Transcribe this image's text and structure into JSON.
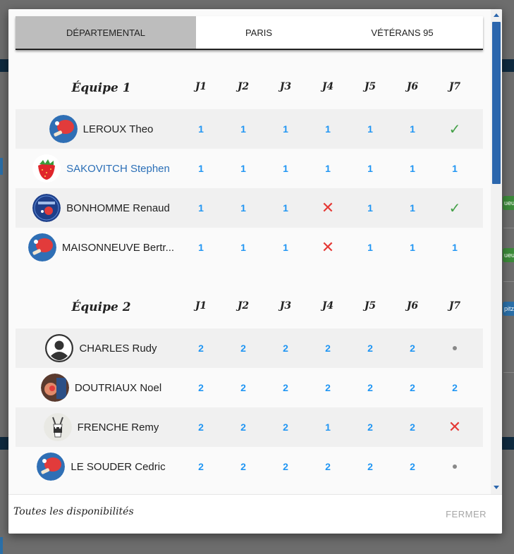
{
  "background": {
    "chips": [
      "ueu",
      "ueu",
      "pitz"
    ]
  },
  "tabs": [
    {
      "label": "DÉPARTEMENTAL",
      "active": true
    },
    {
      "label": "PARIS",
      "active": false
    },
    {
      "label": "VÉTÉRANS 95",
      "active": false
    }
  ],
  "sections": [
    {
      "title": "Équipe 1",
      "days": [
        "J1",
        "J2",
        "J3",
        "J4",
        "J5",
        "J6",
        "J7"
      ],
      "players": [
        {
          "name": "LEROUX Theo",
          "avatar": "ping-pong-paddle-avatar",
          "highlight": false,
          "cells": [
            "1",
            "1",
            "1",
            "1",
            "1",
            "1",
            "check"
          ]
        },
        {
          "name": "SAKOVITCH Stephen",
          "avatar": "strawberry-avatar",
          "highlight": true,
          "cells": [
            "1",
            "1",
            "1",
            "1",
            "1",
            "1",
            "1"
          ]
        },
        {
          "name": "BONHOMME Renaud",
          "avatar": "pingpong-logo-avatar",
          "highlight": false,
          "cells": [
            "1",
            "1",
            "1",
            "x",
            "1",
            "1",
            "check"
          ]
        },
        {
          "name": "MAISONNEUVE Bertr...",
          "avatar": "ping-pong-paddle-avatar",
          "highlight": false,
          "cells": [
            "1",
            "1",
            "1",
            "x",
            "1",
            "1",
            "1"
          ]
        }
      ]
    },
    {
      "title": "Équipe 2",
      "days": [
        "J1",
        "J2",
        "J3",
        "J4",
        "J5",
        "J6",
        "J7"
      ],
      "players": [
        {
          "name": "CHARLES Rudy",
          "avatar": "default-user-avatar",
          "highlight": false,
          "cells": [
            "2",
            "2",
            "2",
            "2",
            "2",
            "2",
            "dot"
          ]
        },
        {
          "name": "DOUTRIAUX Noel",
          "avatar": "photo-avatar",
          "highlight": false,
          "cells": [
            "2",
            "2",
            "2",
            "2",
            "2",
            "2",
            "2"
          ]
        },
        {
          "name": "FRENCHE Remy",
          "avatar": "goat-avatar",
          "highlight": false,
          "cells": [
            "2",
            "2",
            "2",
            "1",
            "2",
            "2",
            "x"
          ]
        },
        {
          "name": "LE SOUDER Cedric",
          "avatar": "ping-pong-paddle-avatar",
          "highlight": false,
          "cells": [
            "2",
            "2",
            "2",
            "2",
            "2",
            "2",
            "dot"
          ]
        }
      ]
    }
  ],
  "footer": {
    "title": "Toutes les disponibilités",
    "close_label": "FERMER"
  },
  "colors": {
    "number": "#2196f3",
    "unavailable": "#e53935",
    "available": "#43a047",
    "scroll_thumb": "#2b66ad",
    "active_tab": "#bdbdbd"
  }
}
